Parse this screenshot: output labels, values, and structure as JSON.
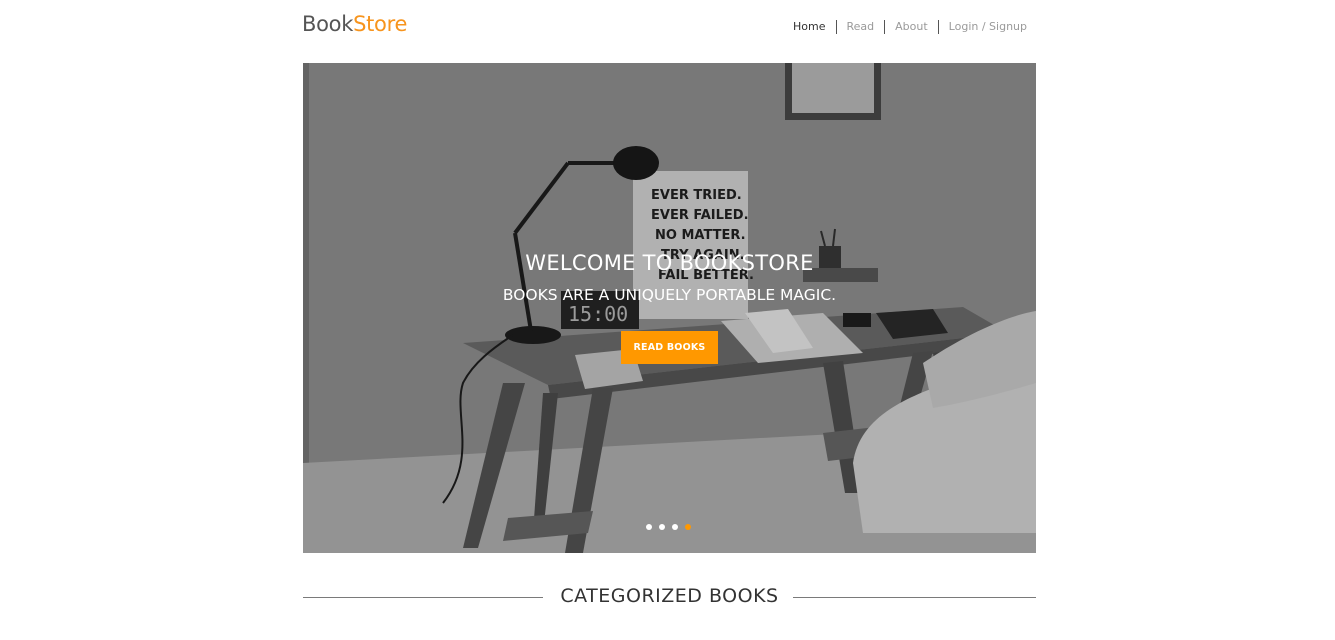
{
  "header": {
    "logo_part1": "Book",
    "logo_part2": "Store",
    "nav": [
      {
        "label": "Home"
      },
      {
        "label": "Read"
      },
      {
        "label": "About"
      },
      {
        "label": "Login / Signup"
      }
    ]
  },
  "hero": {
    "title": "WELCOME TO BOOKSTORE",
    "subtitle": "BOOKS ARE A UNIQUELY PORTABLE MAGIC.",
    "button_label": "READ BOOKS",
    "poster_lines": [
      "EVER TRIED.",
      "EVER FAILED.",
      "NO MATTER.",
      "TRY AGAIN.",
      "FAIL BETTER."
    ],
    "clock_text": "15:00",
    "carousel_slide_count": 4,
    "carousel_active_index": 3
  },
  "section": {
    "title": "CATEGORIZED BOOKS"
  },
  "colors": {
    "accent": "#ff9800",
    "logo_accent": "#f7941d",
    "text": "#333333"
  }
}
